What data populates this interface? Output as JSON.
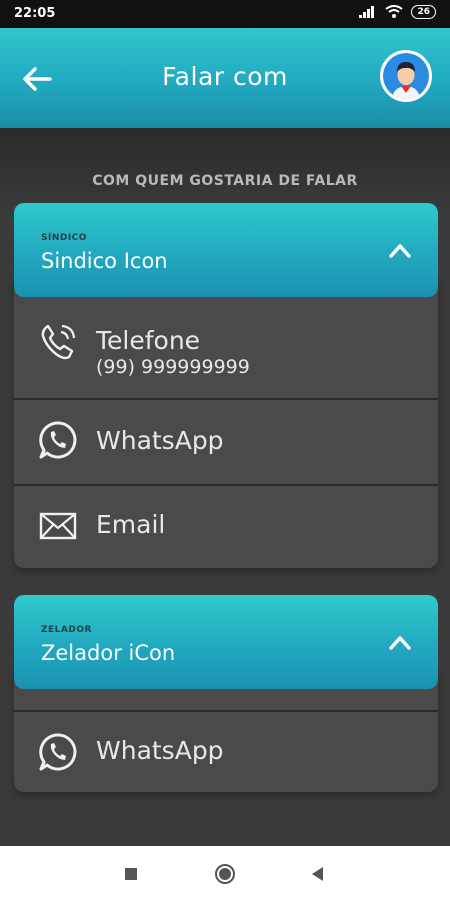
{
  "status_bar": {
    "time": "22:05",
    "battery": "26"
  },
  "header": {
    "title": "Falar com",
    "back_icon": "arrow-left-icon",
    "avatar_icon": "user-avatar-icon"
  },
  "section_heading": "COM QUEM GOSTARIA DE FALAR",
  "contacts": [
    {
      "role": "SÍNDICO",
      "name": "Sindico Icon",
      "options": [
        {
          "label": "Telefone",
          "sub": "(99) 999999999",
          "icon": "phone-icon"
        },
        {
          "label": "WhatsApp",
          "icon": "whatsapp-icon"
        },
        {
          "label": "Email",
          "icon": "envelope-icon"
        }
      ]
    },
    {
      "role": "ZELADOR",
      "name": "Zelador iCon",
      "options": [
        {
          "label": "WhatsApp",
          "icon": "whatsapp-icon"
        }
      ]
    }
  ],
  "colors": {
    "accent_top": "#2ecbcc",
    "accent_bottom": "#1b93b0",
    "background": "#3a3a3a",
    "card": "#4a4a4a"
  }
}
